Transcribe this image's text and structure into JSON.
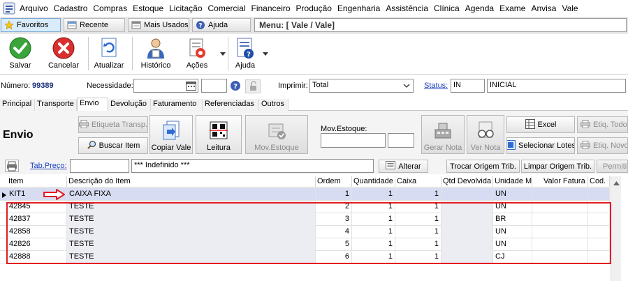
{
  "menubar": {
    "items": [
      "Arquivo",
      "Cadastro",
      "Compras",
      "Estoque",
      "Licitação",
      "Comercial",
      "Financeiro",
      "Produção",
      "Engenharia",
      "Assistência",
      "Clínica",
      "Agenda",
      "Exame",
      "Anvisa",
      "Vale"
    ]
  },
  "favbar": {
    "favoritos": "Favoritos",
    "recente": "Recente",
    "mais_usados": "Mais Usados",
    "ajuda": "Ajuda",
    "menu_path": "Menu: [ Vale / Vale]"
  },
  "toolbar": {
    "salvar": "Salvar",
    "cancelar": "Cancelar",
    "atualizar": "Atualizar",
    "historico": "Histórico",
    "acoes": "Ações",
    "ajuda": "Ajuda"
  },
  "form": {
    "numero_label": "Número:",
    "numero_value": "99389",
    "necessidade_label": "Necessidade:",
    "necessidade_value": "",
    "hora_value": "",
    "imprimir_label": "Imprimir:",
    "imprimir_value": "Total",
    "status_label": "Status:",
    "status_code": "IN",
    "status_desc": "INICIAL"
  },
  "tabs": [
    "Principal",
    "Transporte",
    "Envio",
    "Devolução",
    "Faturamento",
    "Referenciadas",
    "Outros"
  ],
  "active_tab": "Envio",
  "envio": {
    "title": "Envio",
    "etiqueta_transp": "Etiqueta Transp.",
    "buscar_item": "Buscar Item",
    "copiar_vale": "Copiar Vale",
    "leitura": "Leitura",
    "mov_estoque_btn": "Mov.Estoque",
    "mov_estoque_label": "Mov.Estoque:",
    "mov_estoque_value1": "",
    "mov_estoque_value2": "",
    "gerar_nota": "Gerar Nota",
    "ver_nota": "Ver Nota",
    "excel": "Excel",
    "selecionar_lotes": "Selecionar Lotes",
    "etiq_todos": "Etiq. Todos",
    "etiq_novo": "Etiq. Novo",
    "tab_preco_label": "Tab.Preço:",
    "tab_preco_code": "",
    "tab_preco_desc": "*** Indefinido ***",
    "alterar": "Alterar",
    "trocar_origem": "Trocar Origem Trib.",
    "limpar_origem": "Limpar Origem Trib.",
    "permitir": "Permitir"
  },
  "grid": {
    "columns": [
      "Item",
      "Descrição do Item",
      "Ordem",
      "Quantidade",
      "Caixa",
      "Qtd Devolvida",
      "Unidade M",
      "Valor Fatura",
      "Cod."
    ],
    "rows": [
      {
        "item": "KIT1",
        "desc": "CAIXA FIXA",
        "ordem": "1",
        "qtd": "1",
        "caixa": "1",
        "qtd_dev": "",
        "unidade": "UN",
        "valor": "",
        "cod": ""
      },
      {
        "item": "42845",
        "desc": "TESTE",
        "ordem": "2",
        "qtd": "1",
        "caixa": "1",
        "qtd_dev": "",
        "unidade": "UN",
        "valor": "",
        "cod": ""
      },
      {
        "item": "42837",
        "desc": "TESTE",
        "ordem": "3",
        "qtd": "1",
        "caixa": "1",
        "qtd_dev": "",
        "unidade": "BR",
        "valor": "",
        "cod": ""
      },
      {
        "item": "42858",
        "desc": "TESTE",
        "ordem": "4",
        "qtd": "1",
        "caixa": "1",
        "qtd_dev": "",
        "unidade": "UN",
        "valor": "",
        "cod": ""
      },
      {
        "item": "42826",
        "desc": "TESTE",
        "ordem": "5",
        "qtd": "1",
        "caixa": "1",
        "qtd_dev": "",
        "unidade": "UN",
        "valor": "",
        "cod": ""
      },
      {
        "item": "42888",
        "desc": "TESTE",
        "ordem": "6",
        "qtd": "1",
        "caixa": "1",
        "qtd_dev": "",
        "unidade": "CJ",
        "valor": "",
        "cod": ""
      }
    ]
  },
  "colors": {
    "highlight_border": "#e31b23",
    "selected_row": "#d7dcf2",
    "link": "#1a3fbf"
  }
}
